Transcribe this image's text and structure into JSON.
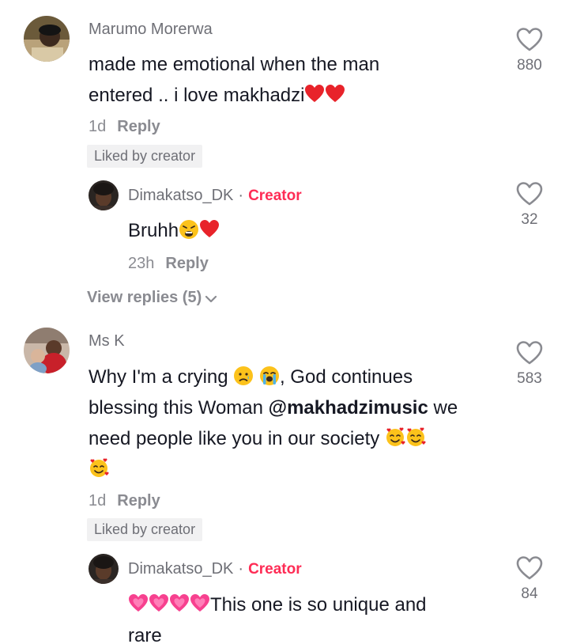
{
  "comments": [
    {
      "author": "Marumo Morerwa",
      "line1": "made me emotional when the man",
      "line2": "entered .. i love makhadzi",
      "time": "1d",
      "reply": "Reply",
      "liked_by": "Liked by creator",
      "likes": "880",
      "replies": [
        {
          "author": "Dimakatso_DK",
          "dot": "·",
          "badge": "Creator",
          "text": "Bruhh",
          "time": "23h",
          "reply": "Reply",
          "likes": "32"
        }
      ],
      "view_replies": "View replies (5)"
    },
    {
      "author": "Ms K",
      "line1a": "Why I'm a crying",
      "line1b": ", God continues",
      "line2a": "blessing this Woman ",
      "mention": "@makhadzimusic",
      "line2b": " we",
      "line3": "need people like you in our society",
      "time": "1d",
      "reply": "Reply",
      "liked_by": "Liked by creator",
      "likes": "583",
      "replies": [
        {
          "author": "Dimakatso_DK",
          "dot": "·",
          "badge": "Creator",
          "text1": "This one is so unique and",
          "text2": "rare",
          "likes": "84"
        }
      ]
    }
  ],
  "icons": {
    "heart_outline": "heart-outline-icon",
    "red_heart": "red-heart-emoji",
    "weary_face": "weary-face-emoji",
    "sad_face": "sad-tear-emoji",
    "crying_face": "loudly-crying-emoji",
    "smiling_hearts": "smiling-face-with-hearts-emoji",
    "pink_heart": "growing-heart-emoji"
  },
  "colors": {
    "creator": "#fe2c55",
    "muted": "#8a8b91",
    "text": "#161823"
  }
}
